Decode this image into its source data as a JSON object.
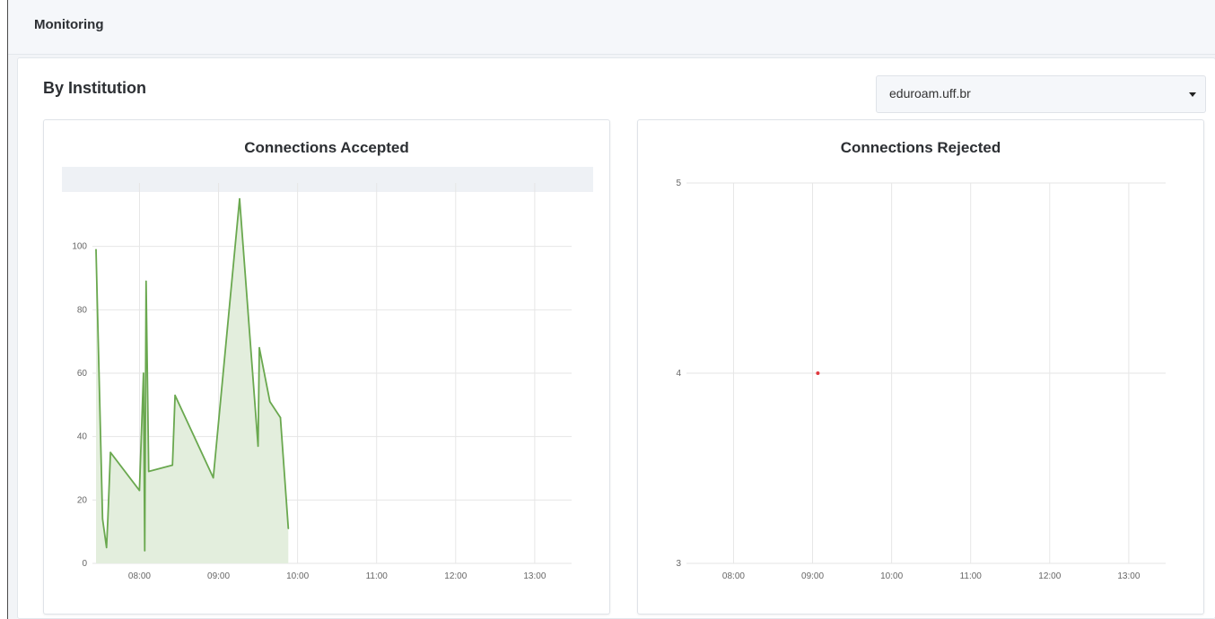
{
  "header": {
    "title": "Monitoring"
  },
  "section": {
    "title": "By Institution"
  },
  "institution_select": {
    "value": "eduroam.uff.br"
  },
  "colors": {
    "accepted_line": "#6aa84f",
    "accepted_fill": "#e3eedd",
    "rejected_point": "#e0383e",
    "grid": "#e6e6e6",
    "legend_band": "#eef1f5"
  },
  "chart_data": [
    {
      "type": "area",
      "title": "Connections Accepted",
      "x_ticks": [
        "08:00",
        "09:00",
        "10:00",
        "11:00",
        "12:00",
        "13:00"
      ],
      "y_ticks": [
        "0",
        "20",
        "40",
        "60",
        "80",
        "100"
      ],
      "xlim": [
        "07:27",
        "13:28"
      ],
      "ylim": [
        0,
        120
      ],
      "grid": true,
      "series": [
        {
          "x": [
            "07:27",
            "07:32",
            "07:35",
            "07:36",
            "07:38",
            "08:00",
            "08:03",
            "08:04",
            "08:05",
            "08:07",
            "08:25",
            "08:27",
            "08:56",
            "09:16",
            "09:30",
            "09:31",
            "09:39",
            "09:47",
            "09:53"
          ],
          "y": [
            99,
            14,
            5,
            14,
            35,
            23,
            60,
            4,
            89,
            29,
            31,
            53,
            27,
            115,
            37,
            68,
            51,
            46,
            11
          ]
        }
      ]
    },
    {
      "type": "scatter",
      "title": "Connections Rejected",
      "x_ticks": [
        "08:00",
        "09:00",
        "10:00",
        "11:00",
        "12:00",
        "13:00"
      ],
      "y_ticks": [
        "3",
        "4",
        "5"
      ],
      "xlim": [
        "07:27",
        "13:28"
      ],
      "ylim": [
        3,
        5
      ],
      "grid": true,
      "series": [
        {
          "x": [
            "09:04"
          ],
          "y": [
            4
          ]
        }
      ]
    }
  ]
}
